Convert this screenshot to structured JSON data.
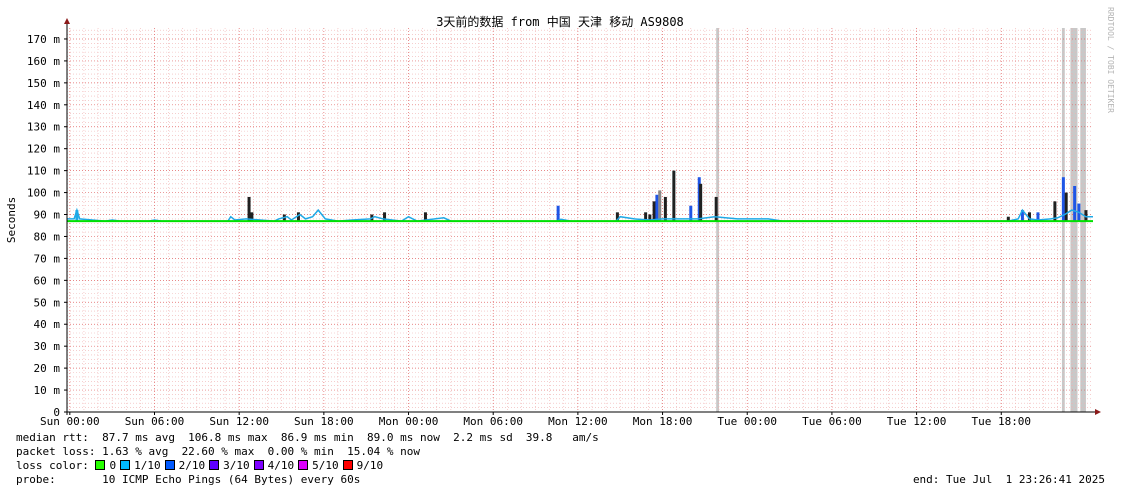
{
  "chart_data": {
    "type": "line",
    "title": "3天前的数据 from 中国 天津 移动 AS9808",
    "ylabel": "Seconds",
    "ylim": [
      0,
      175
    ],
    "y_ticks": [
      "0",
      "10 m",
      "20 m",
      "30 m",
      "40 m",
      "50 m",
      "60 m",
      "70 m",
      "80 m",
      "90 m",
      "100 m",
      "110 m",
      "120 m",
      "130 m",
      "140 m",
      "150 m",
      "160 m",
      "170 m"
    ],
    "x_ticks": [
      "Sun 00:00",
      "Sun 06:00",
      "Sun 12:00",
      "Sun 18:00",
      "Mon 00:00",
      "Mon 06:00",
      "Mon 12:00",
      "Mon 18:00",
      "Tue 00:00",
      "Tue 06:00",
      "Tue 12:00",
      "Tue 18:00"
    ],
    "x_hours_range": [
      -0.2,
      72.5
    ],
    "grid": true,
    "series": [
      {
        "color": "#1fa9e6",
        "points": [
          [
            -0.2,
            88
          ],
          [
            0.3,
            88
          ],
          [
            0.5,
            92
          ],
          [
            0.7,
            88
          ],
          [
            2.5,
            87
          ],
          [
            3.0,
            87.5
          ],
          [
            3.6,
            87
          ],
          [
            5.6,
            87
          ],
          [
            6.0,
            87.5
          ],
          [
            6.5,
            87
          ],
          [
            11.2,
            87
          ],
          [
            11.4,
            89
          ],
          [
            11.7,
            87.5
          ],
          [
            12.5,
            88
          ],
          [
            14.5,
            87
          ],
          [
            14.8,
            88
          ],
          [
            15.4,
            89
          ],
          [
            15.7,
            87.5
          ],
          [
            16.3,
            90
          ],
          [
            16.7,
            88
          ],
          [
            17.2,
            89
          ],
          [
            17.6,
            92
          ],
          [
            18.1,
            88
          ],
          [
            19.0,
            87
          ],
          [
            20.0,
            87.5
          ],
          [
            21.3,
            88
          ],
          [
            21.6,
            89
          ],
          [
            22.2,
            88
          ],
          [
            23.5,
            87
          ],
          [
            24.0,
            89
          ],
          [
            24.6,
            87
          ],
          [
            26.5,
            88.5
          ],
          [
            27.0,
            87
          ],
          [
            32.2,
            87
          ],
          [
            34.5,
            87
          ],
          [
            34.8,
            87.8
          ],
          [
            35.5,
            87
          ],
          [
            37.3,
            87
          ],
          [
            38.7,
            87
          ],
          [
            39.0,
            89
          ],
          [
            40.0,
            88
          ],
          [
            41.1,
            87.5
          ],
          [
            42.0,
            88
          ],
          [
            43.5,
            88
          ],
          [
            44.5,
            88
          ],
          [
            45.7,
            89
          ],
          [
            47.3,
            88
          ],
          [
            49.5,
            88
          ],
          [
            50.5,
            87
          ],
          [
            52.0,
            87
          ],
          [
            57.0,
            87
          ],
          [
            62.0,
            87
          ],
          [
            66.5,
            87
          ],
          [
            67.2,
            88
          ],
          [
            67.5,
            92
          ],
          [
            68.0,
            88
          ],
          [
            68.6,
            87.5
          ],
          [
            69.5,
            88
          ],
          [
            70.0,
            88.5
          ],
          [
            70.5,
            90
          ],
          [
            71.0,
            92
          ],
          [
            71.5,
            91
          ],
          [
            72.0,
            89
          ],
          [
            72.5,
            89
          ]
        ]
      },
      {
        "color": "#00e000",
        "points": [
          [
            -0.2,
            87
          ],
          [
            72.5,
            87
          ]
        ]
      }
    ],
    "spikes": [
      {
        "x": 0.5,
        "y": 92,
        "color": "#1fa9e6"
      },
      {
        "x": 12.7,
        "y": 98,
        "color": "#202020"
      },
      {
        "x": 12.9,
        "y": 91,
        "color": "#202020"
      },
      {
        "x": 15.2,
        "y": 90,
        "color": "#202020"
      },
      {
        "x": 16.2,
        "y": 91,
        "color": "#202020"
      },
      {
        "x": 21.4,
        "y": 90,
        "color": "#202020"
      },
      {
        "x": 22.3,
        "y": 91,
        "color": "#202020"
      },
      {
        "x": 25.2,
        "y": 91,
        "color": "#202020"
      },
      {
        "x": 34.6,
        "y": 94,
        "color": "#1f55e6"
      },
      {
        "x": 38.8,
        "y": 91,
        "color": "#202020"
      },
      {
        "x": 40.8,
        "y": 91,
        "color": "#202020"
      },
      {
        "x": 41.1,
        "y": 90,
        "color": "#202020"
      },
      {
        "x": 41.4,
        "y": 96,
        "color": "#202020"
      },
      {
        "x": 41.6,
        "y": 99,
        "color": "#1f55e6"
      },
      {
        "x": 41.8,
        "y": 101,
        "color": "#888888"
      },
      {
        "x": 42.2,
        "y": 98,
        "color": "#202020"
      },
      {
        "x": 42.8,
        "y": 110,
        "color": "#202020"
      },
      {
        "x": 44.0,
        "y": 94,
        "color": "#1f55e6"
      },
      {
        "x": 44.6,
        "y": 107,
        "color": "#1f55e6"
      },
      {
        "x": 44.7,
        "y": 104,
        "color": "#202020"
      },
      {
        "x": 45.8,
        "y": 98,
        "color": "#202020"
      },
      {
        "x": 66.5,
        "y": 89,
        "color": "#202020"
      },
      {
        "x": 67.5,
        "y": 92,
        "color": "#1f55e6"
      },
      {
        "x": 68.0,
        "y": 91,
        "color": "#202020"
      },
      {
        "x": 68.6,
        "y": 91,
        "color": "#1f55e6"
      },
      {
        "x": 69.8,
        "y": 96,
        "color": "#202020"
      },
      {
        "x": 70.4,
        "y": 107,
        "color": "#1f55e6"
      },
      {
        "x": 70.6,
        "y": 100,
        "color": "#202020"
      },
      {
        "x": 71.2,
        "y": 103,
        "color": "#1f55e6"
      },
      {
        "x": 71.5,
        "y": 95,
        "color": "#1f55e6"
      },
      {
        "x": 72.0,
        "y": 92,
        "color": "#202020"
      }
    ],
    "loss_bands": [
      [
        45.8,
        46.0
      ],
      [
        70.3,
        70.5
      ],
      [
        70.9,
        71.4
      ],
      [
        71.6,
        72.0
      ]
    ],
    "colors": {
      "grid_major": "#e06060",
      "grid_minor": "#f0b0b0",
      "loss_band": "#c8c8c8",
      "axis": "#000000",
      "arrow": "#8b1a1a"
    }
  },
  "side_label": "RRDTOOL / TOBI OETIKER",
  "stats": {
    "median_rtt": "median rtt:  87.7 ms avg  106.8 ms max  86.9 ms min  89.0 ms now  2.2 ms sd  39.8   am/s",
    "packet_loss": "packet loss: 1.63 % avg  22.60 % max  0.00 % min  15.04 % now",
    "loss_color_label": "loss color:",
    "loss_colors": [
      {
        "label": "0",
        "color": "#26ff00"
      },
      {
        "label": "1/10",
        "color": "#00b8ff"
      },
      {
        "label": "2/10",
        "color": "#0059ff"
      },
      {
        "label": "3/10",
        "color": "#5e00ff"
      },
      {
        "label": "4/10",
        "color": "#7e00ff"
      },
      {
        "label": "5/10",
        "color": "#dd00ff"
      },
      {
        "label": "9/10",
        "color": "#ff0000"
      }
    ],
    "probe": "probe:       10 ICMP Echo Pings (64 Bytes) every 60s",
    "end": "end: Tue Jul  1 23:26:41 2025"
  }
}
